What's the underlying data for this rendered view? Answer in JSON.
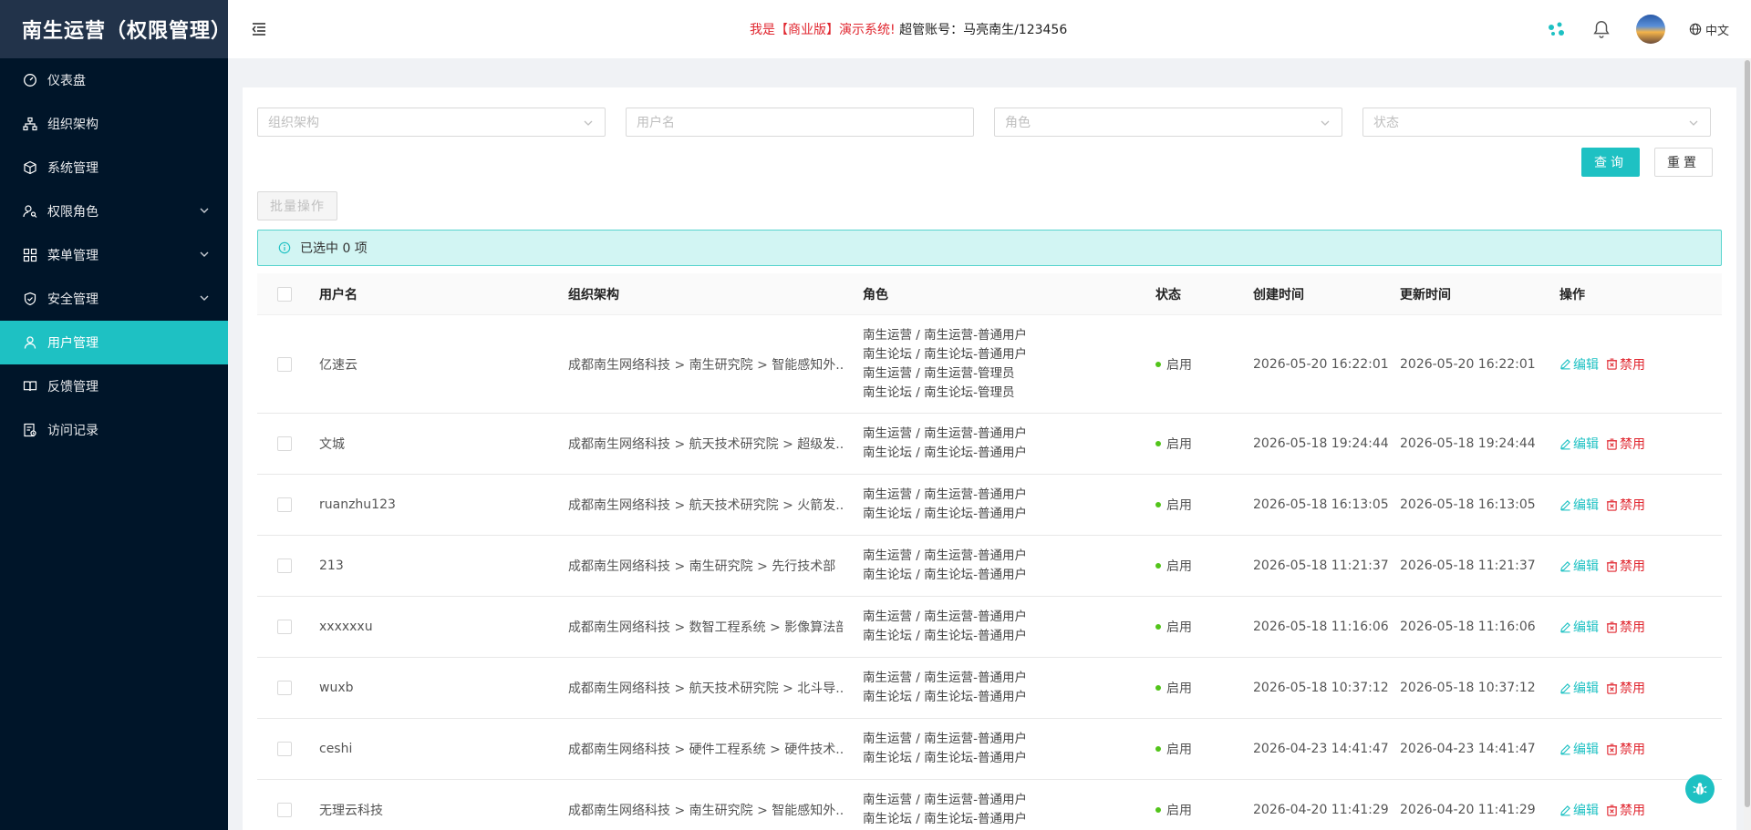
{
  "app": {
    "title": "南生运营（权限管理）"
  },
  "sidebar": {
    "items": [
      {
        "label": "仪表盘",
        "icon": "dashboard-icon",
        "expandable": false,
        "active": false
      },
      {
        "label": "组织架构",
        "icon": "org-chart-icon",
        "expandable": false,
        "active": false
      },
      {
        "label": "系统管理",
        "icon": "cube-icon",
        "expandable": false,
        "active": false
      },
      {
        "label": "权限角色",
        "icon": "user-key-icon",
        "expandable": true,
        "active": false
      },
      {
        "label": "菜单管理",
        "icon": "grid-icon",
        "expandable": true,
        "active": false
      },
      {
        "label": "安全管理",
        "icon": "shield-icon",
        "expandable": true,
        "active": false
      },
      {
        "label": "用户管理",
        "icon": "user-icon",
        "expandable": false,
        "active": true
      },
      {
        "label": "反馈管理",
        "icon": "book-icon",
        "expandable": false,
        "active": false
      },
      {
        "label": "访问记录",
        "icon": "record-icon",
        "expandable": false,
        "active": false
      }
    ]
  },
  "header": {
    "notice_prefix": "我是【商业版】演示系统!",
    "notice_account": "超管账号：马亮南生/123456",
    "language": "中文"
  },
  "filters": {
    "org_placeholder": "组织架构",
    "username_placeholder": "用户名",
    "role_placeholder": "角色",
    "status_placeholder": "状态",
    "query_label": "查询",
    "reset_label": "重置"
  },
  "toolbar": {
    "batch_label": "批量操作"
  },
  "alert": {
    "selected_text": "已选中 0 项"
  },
  "table": {
    "columns": [
      "用户名",
      "组织架构",
      "角色",
      "状态",
      "创建时间",
      "更新时间",
      "操作"
    ],
    "edit_label": "编辑",
    "ban_label": "禁用",
    "rows": [
      {
        "username": "亿速云",
        "org": "成都南生网络科技 > 南生研究院 > 智能感知外...",
        "roles": [
          "南生运营 / 南生运营-普通用户",
          "南生论坛 / 南生论坛-普通用户",
          "南生运营 / 南生运营-管理员",
          "南生论坛 / 南生论坛-管理员"
        ],
        "status": "启用",
        "created": "2026-05-20 16:22:01",
        "updated": "2026-05-20 16:22:01"
      },
      {
        "username": "文城",
        "org": "成都南生网络科技 > 航天技术研究院 > 超级发...",
        "roles": [
          "南生运营 / 南生运营-普通用户",
          "南生论坛 / 南生论坛-普通用户"
        ],
        "status": "启用",
        "created": "2026-05-18 19:24:44",
        "updated": "2026-05-18 19:24:44"
      },
      {
        "username": "ruanzhu123",
        "org": "成都南生网络科技 > 航天技术研究院 > 火箭发...",
        "roles": [
          "南生运营 / 南生运营-普通用户",
          "南生论坛 / 南生论坛-普通用户"
        ],
        "status": "启用",
        "created": "2026-05-18 16:13:05",
        "updated": "2026-05-18 16:13:05"
      },
      {
        "username": "213",
        "org": "成都南生网络科技 > 南生研究院 > 先行技术部",
        "roles": [
          "南生运营 / 南生运营-普通用户",
          "南生论坛 / 南生论坛-普通用户"
        ],
        "status": "启用",
        "created": "2026-05-18 11:21:37",
        "updated": "2026-05-18 11:21:37"
      },
      {
        "username": "xxxxxxu",
        "org": "成都南生网络科技 > 数智工程系统 > 影像算法部",
        "roles": [
          "南生运营 / 南生运营-普通用户",
          "南生论坛 / 南生论坛-普通用户"
        ],
        "status": "启用",
        "created": "2026-05-18 11:16:06",
        "updated": "2026-05-18 11:16:06"
      },
      {
        "username": "wuxb",
        "org": "成都南生网络科技 > 航天技术研究院 > 北斗导...",
        "roles": [
          "南生运营 / 南生运营-普通用户",
          "南生论坛 / 南生论坛-普通用户"
        ],
        "status": "启用",
        "created": "2026-05-18 10:37:12",
        "updated": "2026-05-18 10:37:12"
      },
      {
        "username": "ceshi",
        "org": "成都南生网络科技 > 硬件工程系统 > 硬件技术...",
        "roles": [
          "南生运营 / 南生运营-普通用户",
          "南生论坛 / 南生论坛-普通用户"
        ],
        "status": "启用",
        "created": "2026-04-23 14:41:47",
        "updated": "2026-04-23 14:41:47"
      },
      {
        "username": "无理云科技",
        "org": "成都南生网络科技 > 南生研究院 > 智能感知外...",
        "roles": [
          "南生运营 / 南生运营-普通用户",
          "南生论坛 / 南生论坛-普通用户"
        ],
        "status": "启用",
        "created": "2026-04-20 11:41:29",
        "updated": "2026-04-20 11:41:29"
      }
    ]
  },
  "colors": {
    "accent": "#1ec1c3",
    "sidebar_bg": "#001529",
    "danger": "#e0262f",
    "success": "#52c41a"
  }
}
